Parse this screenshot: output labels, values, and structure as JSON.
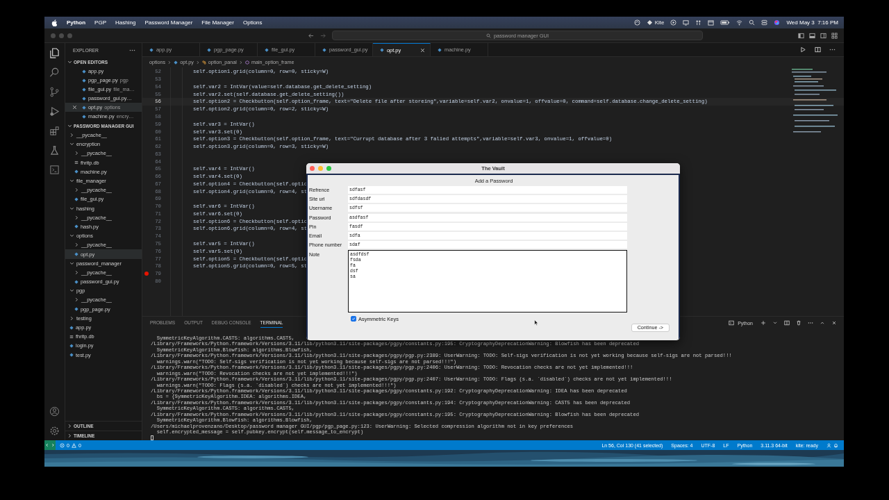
{
  "menu_bar": {
    "app": "Python",
    "menus": [
      "PGP",
      "Hashing",
      "Password Manager",
      "File Manager",
      "Options"
    ],
    "kite": "Kite",
    "clock": "Wed May 3  7:16 PM"
  },
  "title_bar": {
    "search": "password manager GUI"
  },
  "sidebar": {
    "title": "EXPLORER",
    "open_editors": {
      "title": "OPEN EDITORS",
      "items": [
        {
          "name": "app.py",
          "selected": false
        },
        {
          "name": "pgp_page.py",
          "detail": "pgp",
          "selected": false
        },
        {
          "name": "file_gui.py",
          "detail": "file_ma…",
          "selected": false
        },
        {
          "name": "password_gui.py…",
          "selected": false
        },
        {
          "name": "opt.py",
          "detail": "options",
          "selected": true
        },
        {
          "name": "machine.py",
          "detail": "encry…",
          "selected": false
        }
      ]
    },
    "project": {
      "title": "PASSWORD MANAGER GUI",
      "items": [
        {
          "name": "__pycache__",
          "kind": "folder",
          "expanded": false,
          "selected": false
        },
        {
          "name": "encryption",
          "kind": "folder",
          "expanded": true,
          "selected": false,
          "children": [
            {
              "name": "__pycache__",
              "kind": "folder",
              "expanded": false,
              "selected": false
            },
            {
              "name": "fhritp.db",
              "kind": "db",
              "selected": false
            },
            {
              "name": "machine.py",
              "kind": "python",
              "selected": false
            }
          ]
        },
        {
          "name": "file_manager",
          "kind": "folder",
          "expanded": true,
          "selected": false,
          "children": [
            {
              "name": "__pycache__",
              "kind": "folder",
              "expanded": false,
              "selected": false
            },
            {
              "name": "file_gui.py",
              "kind": "python",
              "selected": false
            }
          ]
        },
        {
          "name": "hashing",
          "kind": "folder",
          "expanded": true,
          "selected": false,
          "children": [
            {
              "name": "__pycache__",
              "kind": "folder",
              "expanded": false,
              "selected": false
            },
            {
              "name": "hash.py",
              "kind": "python",
              "selected": false
            }
          ]
        },
        {
          "name": "options",
          "kind": "folder",
          "expanded": true,
          "selected": false,
          "children": [
            {
              "name": "__pycache__",
              "kind": "folder",
              "expanded": false,
              "selected": false
            },
            {
              "name": "opt.py",
              "kind": "python",
              "selected": true
            }
          ]
        },
        {
          "name": "password_manager",
          "kind": "folder",
          "expanded": true,
          "selected": false,
          "children": [
            {
              "name": "__pycache__",
              "kind": "folder",
              "expanded": false,
              "selected": false
            },
            {
              "name": "password_gui.py",
              "kind": "python",
              "selected": false
            }
          ]
        },
        {
          "name": "pgp",
          "kind": "folder",
          "expanded": true,
          "selected": false,
          "children": [
            {
              "name": "__pycache__",
              "kind": "folder",
              "expanded": false,
              "selected": false
            },
            {
              "name": "pgp_page.py",
              "kind": "python",
              "selected": false
            }
          ]
        },
        {
          "name": "testing",
          "kind": "folder",
          "expanded": false,
          "selected": false
        },
        {
          "name": "app.py",
          "kind": "python",
          "selected": false
        },
        {
          "name": "fhritp.db",
          "kind": "db",
          "selected": false
        },
        {
          "name": "login.py",
          "kind": "python",
          "selected": false
        },
        {
          "name": "test.py",
          "kind": "python",
          "selected": false
        }
      ]
    },
    "sections": [
      "OUTLINE",
      "TIMELINE"
    ]
  },
  "tabs": [
    {
      "label": "app.py",
      "selected": false
    },
    {
      "label": "pgp_page.py",
      "selected": false
    },
    {
      "label": "file_gui.py",
      "selected": false
    },
    {
      "label": "password_gui.py",
      "selected": false
    },
    {
      "label": "opt.py",
      "selected": true
    },
    {
      "label": "machine.py",
      "selected": false
    }
  ],
  "breadcrumb": [
    "options",
    "opt.py",
    "option_panal",
    "main_option_frame"
  ],
  "code": [
    {
      "number": "52",
      "text": "self.option1.grid(column=0, row=0, sticky=W)",
      "current": false,
      "breakpoint": false
    },
    {
      "number": "53",
      "current": false,
      "breakpoint": false
    },
    {
      "number": "54",
      "text": "self.var2 = IntVar(value=self.database.get_delete_setting)",
      "current": false,
      "breakpoint": false
    },
    {
      "number": "55",
      "text": "self.var2.set(self.database.get_delete_setting())",
      "current": false,
      "breakpoint": false
    },
    {
      "number": "56",
      "text": "self.option2 = Checkbutton(self.option_frame, text=\"Delete file after storeing\",variable=self.var2, onvalue=1, offvalue=0, command=self.database.change_delete_setting)",
      "current": true,
      "breakpoint": false
    },
    {
      "number": "57",
      "text": "self.option2.grid(column=0, row=2, sticky=W)",
      "current": false,
      "breakpoint": false
    },
    {
      "number": "58",
      "current": false,
      "breakpoint": false
    },
    {
      "number": "59",
      "text": "self.var3 = IntVar()",
      "current": false,
      "breakpoint": false
    },
    {
      "number": "60",
      "text": "self.var3.set(0)",
      "current": false,
      "breakpoint": false
    },
    {
      "number": "61",
      "text": "self.option3 = Checkbutton(self.option_frame, text=\"Currupt database after 3 falied attempts\",variable=self.var3, onvalue=1, offvalue=0)",
      "current": false,
      "breakpoint": false
    },
    {
      "number": "62",
      "text": "self.option3.grid(column=0, row=3, sticky=W)",
      "current": false,
      "breakpoint": false
    },
    {
      "number": "63",
      "current": false,
      "breakpoint": false
    },
    {
      "number": "64",
      "current": false,
      "breakpoint": false
    },
    {
      "number": "65",
      "text": "self.var4 = IntVar()",
      "current": false,
      "breakpoint": false
    },
    {
      "number": "66",
      "text": "self.var4.set(0)",
      "current": false,
      "breakpoint": false
    },
    {
      "number": "67",
      "text": "self.option4 = Checkbutton(self.optio",
      "current": false,
      "breakpoint": false
    },
    {
      "number": "68",
      "text": "self.option4.grid(column=0, row=4, st",
      "current": false,
      "breakpoint": false
    },
    {
      "number": "69",
      "current": false,
      "breakpoint": false
    },
    {
      "number": "70",
      "text": "self.var6 = IntVar()",
      "current": false,
      "breakpoint": false
    },
    {
      "number": "71",
      "text": "self.var6.set(0)",
      "current": false,
      "breakpoint": false
    },
    {
      "number": "72",
      "text": "self.option6 = Checkbutton(self.optio",
      "current": false,
      "breakpoint": false
    },
    {
      "number": "73",
      "text": "self.option6.grid(column=0, row=4, st",
      "current": false,
      "breakpoint": false
    },
    {
      "number": "74",
      "current": false,
      "breakpoint": false
    },
    {
      "number": "75",
      "text": "self.var5 = IntVar()",
      "current": false,
      "breakpoint": false
    },
    {
      "number": "76",
      "text": "self.var5.set(0)",
      "current": false,
      "breakpoint": false
    },
    {
      "number": "77",
      "text": "self.option5 = Checkbutton(self.optio",
      "current": false,
      "breakpoint": false
    },
    {
      "number": "78",
      "text": "self.option5.grid(column=0, row=5, st",
      "current": false,
      "breakpoint": false
    },
    {
      "number": "79",
      "current": false,
      "breakpoint": true
    },
    {
      "number": "80",
      "current": false,
      "breakpoint": false
    }
  ],
  "panel": {
    "tabs": [
      {
        "label": "PROBLEMS",
        "selected": false
      },
      {
        "label": "OUTPUT",
        "selected": false
      },
      {
        "label": "DEBUG CONSOLE",
        "selected": false
      },
      {
        "label": "TERMINAL",
        "selected": true
      }
    ],
    "shell": "Python",
    "terminal": [
      "  SymmetricKeyAlgorithm.CAST5: algorithms.CAST5,",
      "/Library/Frameworks/Python.framework/Versions/3.11/lib/python3.11/site-packages/pgpy/constants.py:195: CryptographyDeprecationWarning: Blowfish has been deprecated",
      "  SymmetricKeyAlgorithm.Blowfish: algorithms.Blowfish,",
      "/Library/Frameworks/Python.framework/Versions/3.11/lib/python3.11/site-packages/pgpy/pgp.py:2389: UserWarning: TODO: Self-sigs verification is not yet working because self-sigs are not parsed!!!",
      "  warnings.warn(\"TODO: Self-sigs verification is not yet working because self-sigs are not parsed!!!\")",
      "/Library/Frameworks/Python.framework/Versions/3.11/lib/python3.11/site-packages/pgpy/pgp.py:2406: UserWarning: TODO: Revocation checks are not yet implemented!!!",
      "  warnings.warn(\"TODO: Revocation checks are not yet implemented!!!\")",
      "/Library/Frameworks/Python.framework/Versions/3.11/lib/python3.11/site-packages/pgpy/pgp.py:2407: UserWarning: TODO: Flags (s.a. `disabled`) checks are not yet implemented!!!",
      "  warnings.warn(\"TODO: Flags (s.a. `disabled`) checks are not yet implemented!!!\")",
      "/Library/Frameworks/Python.framework/Versions/3.11/lib/python3.11/site-packages/pgpy/constants.py:192: CryptographyDeprecationWarning: IDEA has been deprecated",
      "  bs = {SymmetricKeyAlgorithm.IDEA: algorithms.IDEA,",
      "/Library/Frameworks/Python.framework/Versions/3.11/lib/python3.11/site-packages/pgpy/constants.py:194: CryptographyDeprecationWarning: CAST5 has been deprecated",
      "  SymmetricKeyAlgorithm.CAST5: algorithms.CAST5,",
      "/Library/Frameworks/Python.framework/Versions/3.11/lib/python3.11/site-packages/pgpy/constants.py:195: CryptographyDeprecationWarning: Blowfish has been deprecated",
      "  SymmetricKeyAlgorithm.Blowfish: algorithms.Blowfish,",
      "/Users/michaelprovenzano/Desktop/password manager GUI/pgp/pgp_page.py:123: UserWarning: Selected compression algorithm not in key preferences",
      "  self.encrypted_message = self.pubkey.encrypt(self.message_to_encrypt)"
    ]
  },
  "status_bar": {
    "errors": "0",
    "warnings": "0",
    "items": [
      "Ln 56, Col 130 (41 selected)",
      "Spaces: 4",
      "UTF-8",
      "LF",
      "Python",
      "3.11.3 64-bit",
      "kite: ready"
    ]
  },
  "dialog": {
    "title": "The Vault",
    "heading": "Add a Password",
    "fields": [
      {
        "label": "Refrence",
        "value": "sdfasf"
      },
      {
        "label": "Site url",
        "value": "sdfdasdf"
      },
      {
        "label": "Username",
        "value": "sdfsf"
      },
      {
        "label": "Password",
        "value": "asdfasf"
      },
      {
        "label": "Pin",
        "value": "fasdf"
      },
      {
        "label": "Email",
        "value": "sdfa"
      },
      {
        "label": "Phone number",
        "value": "sdaf"
      }
    ],
    "note": {
      "label": "Note",
      "lines": [
        "asdfdsf",
        "fsda",
        "fa",
        "dsf",
        "sa"
      ]
    },
    "checkbox": {
      "label": "Asymmetric Keys",
      "checked": true
    },
    "button": "Continue ->"
  }
}
